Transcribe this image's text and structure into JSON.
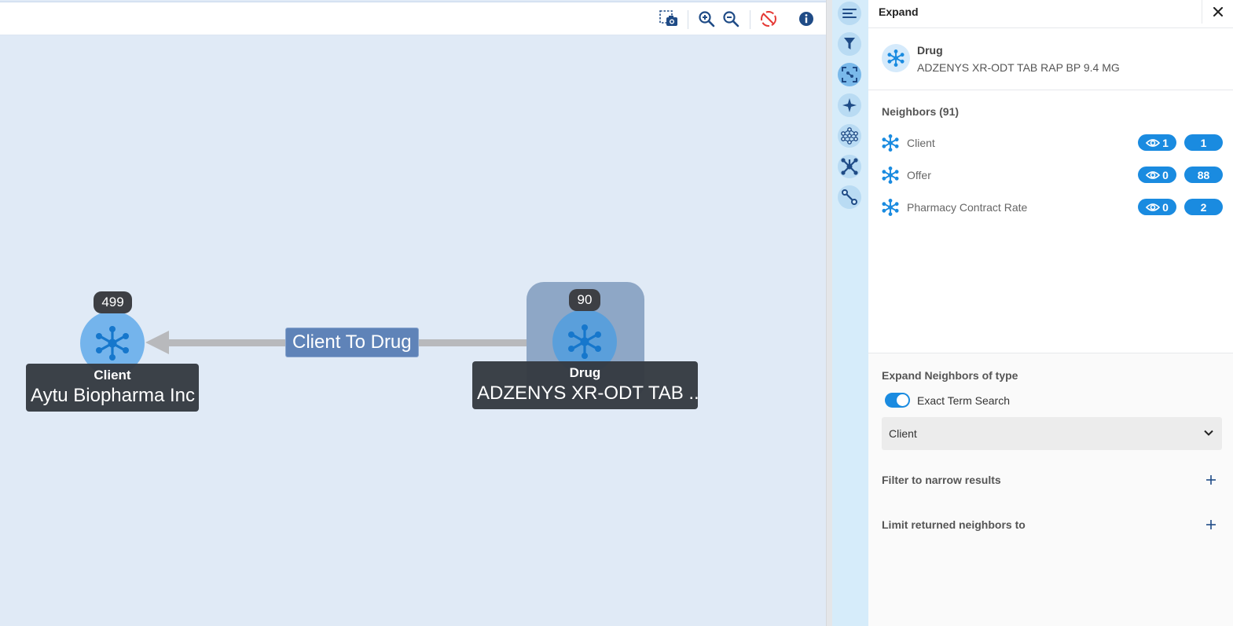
{
  "toolbar": {
    "screenshot_icon": "camera-selection-icon",
    "zoom_in_icon": "zoom-in-icon",
    "zoom_out_icon": "zoom-out-icon",
    "disable_icon": "no-physics-icon",
    "info_icon": "info-icon",
    "disable_color": "#e53935",
    "icon_color": "#1f4b86"
  },
  "graph": {
    "edge_label": "Client To Drug",
    "client_node": {
      "count": "499",
      "type": "Client",
      "name": "Aytu Biopharma Inc"
    },
    "drug_node": {
      "count": "90",
      "type": "Drug",
      "name": "ADZENYS XR-ODT TAB ..."
    }
  },
  "rail": {
    "items": [
      "menu-icon",
      "filter-icon",
      "expand-icon",
      "sparkle-icon",
      "network-icon",
      "hub-icon",
      "path-icon"
    ],
    "active": "expand-icon"
  },
  "panel": {
    "title": "Expand",
    "close_icon": "close-icon",
    "selected": {
      "type": "Drug",
      "name": "ADZENYS XR-ODT TAB RAP BP 9.4 MG"
    },
    "neighbors_title": "Neighbors (91)",
    "neighbors": [
      {
        "label": "Client",
        "visible": "1",
        "count": "1"
      },
      {
        "label": "Offer",
        "visible": "0",
        "count": "88"
      },
      {
        "label": "Pharmacy Contract Rate",
        "visible": "0",
        "count": "2"
      }
    ],
    "expand_title": "Expand Neighbors of type",
    "exact_term_label": "Exact Term Search",
    "exact_term_on": true,
    "type_select_value": "Client",
    "filter_title": "Filter to narrow results",
    "limit_title": "Limit returned neighbors to"
  },
  "colors": {
    "accent": "#1a8be0",
    "canvas_bg": "#e0eaf6",
    "rail_bg": "#d6ecfa",
    "node": "#74b4ec"
  }
}
